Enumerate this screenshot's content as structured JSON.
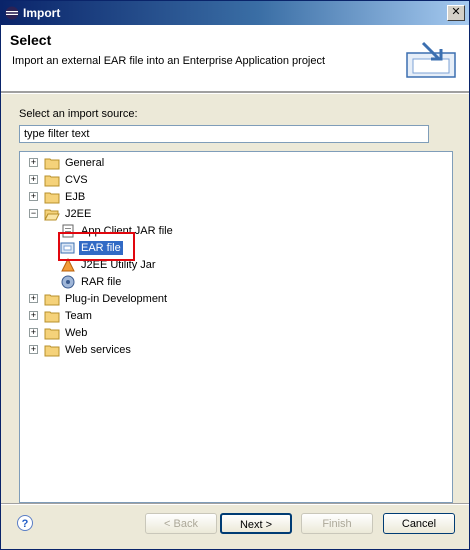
{
  "window": {
    "title": "Import",
    "close_label": "✕"
  },
  "header": {
    "title": "Select",
    "description": "Import an external EAR file into an Enterprise Application project"
  },
  "source": {
    "label": "Select an import source:",
    "filter_value": "type filter text"
  },
  "tree": {
    "items": [
      {
        "label": "General",
        "expander": "+",
        "icon": "folder-icon"
      },
      {
        "label": "CVS",
        "expander": "+",
        "icon": "folder-icon"
      },
      {
        "label": "EJB",
        "expander": "+",
        "icon": "folder-icon"
      },
      {
        "label": "J2EE",
        "expander": "−",
        "icon": "folder-open-icon"
      },
      {
        "label": "App Client JAR file",
        "icon": "jar-icon"
      },
      {
        "label": "EAR file",
        "icon": "ear-icon",
        "selected": true
      },
      {
        "label": "J2EE Utility Jar",
        "icon": "utility-jar-icon"
      },
      {
        "label": "RAR file",
        "icon": "rar-icon"
      },
      {
        "label": "Plug-in Development",
        "expander": "+",
        "icon": "folder-icon"
      },
      {
        "label": "Team",
        "expander": "+",
        "icon": "folder-icon"
      },
      {
        "label": "Web",
        "expander": "+",
        "icon": "folder-icon"
      },
      {
        "label": "Web services",
        "expander": "+",
        "icon": "folder-icon"
      }
    ]
  },
  "buttons": {
    "help": "?",
    "back": "< Back",
    "next": "Next >",
    "finish": "Finish",
    "cancel": "Cancel"
  },
  "colors": {
    "title_bar": "#0a246a",
    "selection": "#316ac5",
    "highlight_box": "#e1070e"
  }
}
